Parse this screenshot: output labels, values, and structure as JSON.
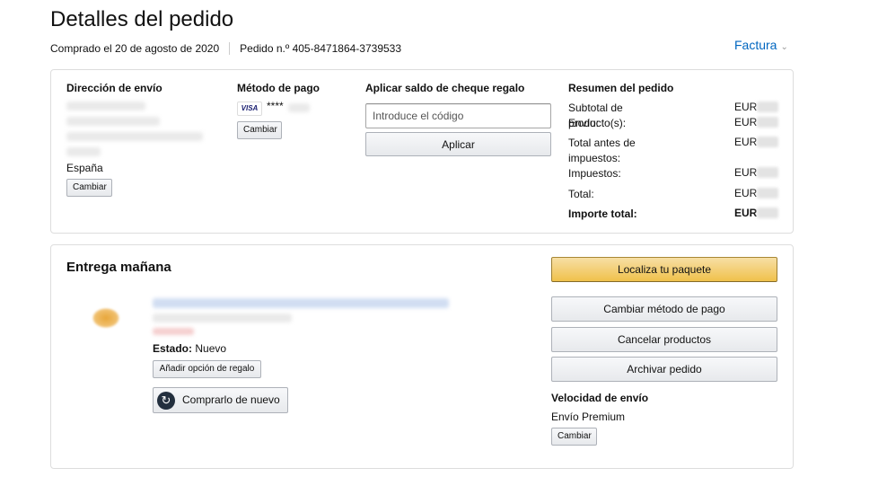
{
  "page": {
    "title": "Detalles del pedido",
    "purchased": "Comprado el 20 de agosto de 2020",
    "order_number": "Pedido n.º 405-8471864-3739533",
    "invoice_label": "Factura"
  },
  "shipping": {
    "heading": "Dirección de envío",
    "country": "España",
    "change_label": "Cambiar"
  },
  "payment": {
    "heading": "Método de pago",
    "card_brand": "VISA",
    "card_mask": "****",
    "change_label": "Cambiar"
  },
  "gift": {
    "heading": "Aplicar saldo de cheque regalo",
    "placeholder": "Introduce el código",
    "apply_label": "Aplicar"
  },
  "summary": {
    "heading": "Resumen del pedido",
    "rows": [
      {
        "label": "Subtotal de producto(s):",
        "currency": "EUR"
      },
      {
        "label": "Envío:",
        "currency": "EUR"
      },
      {
        "label": "Total antes de impuestos:",
        "currency": "EUR"
      },
      {
        "label": "Impuestos:",
        "currency": "EUR"
      },
      {
        "label": "Total:",
        "currency": "EUR"
      },
      {
        "label": "Importe total:",
        "currency": "EUR"
      }
    ]
  },
  "shipment": {
    "heading": "Entrega mañana",
    "status_label": "Estado:",
    "status_value": "Nuevo",
    "gift_option_label": "Añadir opción de regalo",
    "buy_again_label": "Comprarlo de nuevo",
    "actions": {
      "track": "Localiza tu paquete",
      "change_payment": "Cambiar método de pago",
      "cancel": "Cancelar productos",
      "archive": "Archivar pedido"
    },
    "speed_heading": "Velocidad de envío",
    "speed_value": "Envío Premium",
    "speed_change_label": "Cambiar"
  },
  "colors": {
    "link": "#0066c0",
    "primary_button": "#f0c14b",
    "border": "#dddddd"
  }
}
